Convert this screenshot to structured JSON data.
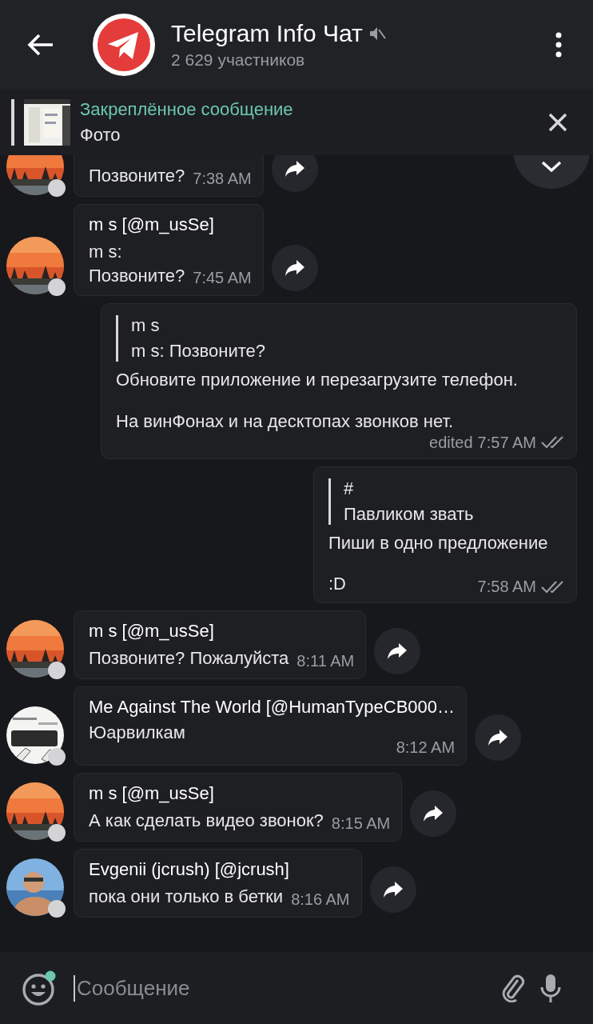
{
  "header": {
    "title": "Telegram Info Чат",
    "muted": true,
    "subtitle": "2 629 участников"
  },
  "pinned": {
    "label": "Закреплённое сообщение",
    "text": "Фото"
  },
  "messages": [
    {
      "kind": "in",
      "text": "Позвоните?",
      "time": "7:38 AM"
    },
    {
      "kind": "in",
      "name": "m s [@m_usSe]",
      "text": "m s:\nПозвоните?",
      "time": "7:45 AM"
    },
    {
      "kind": "out",
      "quote_name": "m s",
      "quote_text": "m s: Позвоните?",
      "paragraphs": [
        "Обновите приложение и перезагрузите телефон.",
        "На винФонах и на десктопах звонков нет."
      ],
      "edited_label": "edited",
      "time": "7:57 AM",
      "read": true
    },
    {
      "kind": "out",
      "quote_name": "#",
      "quote_text": "Павликом звать",
      "paragraphs": [
        "Пиши в одно предложение",
        ":D"
      ],
      "time": "7:58 AM",
      "read": true
    },
    {
      "kind": "in",
      "name": "m s [@m_usSe]",
      "text": "Позвоните? Пожалуйста",
      "time": "8:11 AM"
    },
    {
      "kind": "in",
      "name": "Me Against The World [@HumanTypeCB000…",
      "text": "Юарвилкам",
      "time": "8:12 AM",
      "time_below": true
    },
    {
      "kind": "in",
      "name": "m s [@m_usSe]",
      "text": "А как сделать видео звонок?",
      "time": "8:15 AM"
    },
    {
      "kind": "in",
      "name": "Evgenii (jcrush) [@jcrush]",
      "text": "пока они только в бетки",
      "time": "8:16 AM"
    }
  ],
  "composer": {
    "placeholder": "Сообщение"
  }
}
